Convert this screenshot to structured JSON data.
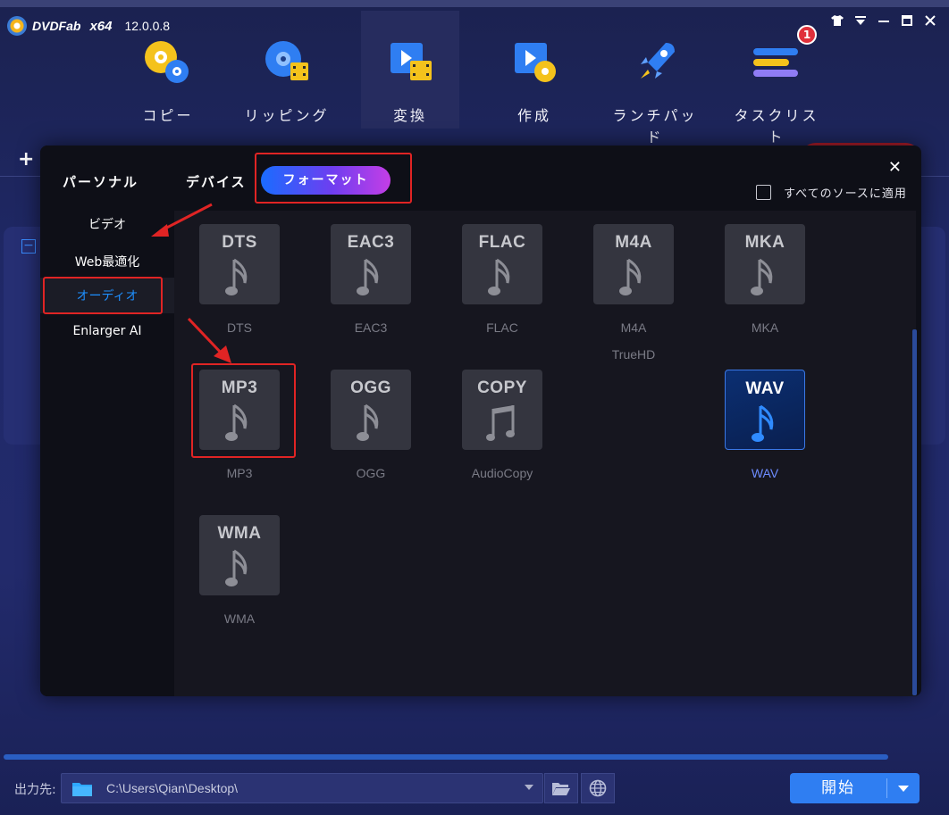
{
  "app": {
    "name": "DVDFab",
    "arch": "x64",
    "version": "12.0.0.8"
  },
  "nav": [
    {
      "label": "コピー",
      "icon": "copy-disc-icon"
    },
    {
      "label": "リッピング",
      "icon": "ripper-icon"
    },
    {
      "label": "変換",
      "icon": "convert-icon",
      "active": true
    },
    {
      "label": "作成",
      "icon": "creator-icon"
    },
    {
      "label": "ランチパッド",
      "icon": "rocket-icon"
    },
    {
      "label": "タスクリスト",
      "icon": "tasklist-icon",
      "badge": "1"
    }
  ],
  "modal": {
    "tabs": {
      "personal": "パーソナル",
      "device": "デバイス",
      "format": "フォーマット"
    },
    "apply_all": "すべてのソースに適用",
    "sidebar": [
      {
        "label": "ビデオ"
      },
      {
        "label": "Web最適化"
      },
      {
        "label": "オーディオ",
        "active": true
      },
      {
        "label": "Enlarger AI"
      }
    ],
    "formats": [
      {
        "code": "DTS",
        "label": "DTS"
      },
      {
        "code": "EAC3",
        "label": "EAC3"
      },
      {
        "code": "FLAC",
        "label": "FLAC"
      },
      {
        "code": "M4A",
        "label": "M4A",
        "sub": "TrueHD"
      },
      {
        "code": "MKA",
        "label": "MKA"
      },
      {
        "code": "MP3",
        "label": "MP3"
      },
      {
        "code": "OGG",
        "label": "OGG"
      },
      {
        "code": "COPY",
        "label": "AudioCopy"
      },
      {
        "code": "WAV",
        "label": "WAV",
        "selected": true
      },
      {
        "code": "WMA",
        "label": "WMA"
      }
    ]
  },
  "bottom": {
    "output_label": "出力先:",
    "path": "C:\\Users\\Qian\\Desktop\\",
    "start": "開始"
  },
  "colors": {
    "accent": "#2f7ef2",
    "highlight": "#e02424",
    "active_side": "#1e8fff",
    "selected_label": "#6d8cff"
  }
}
